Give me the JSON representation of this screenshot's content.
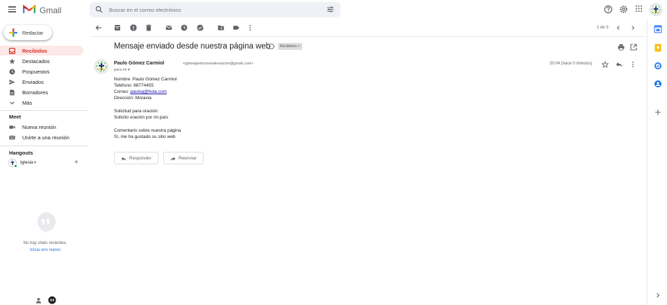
{
  "app": {
    "name": "Gmail"
  },
  "search": {
    "placeholder": "Buscar en el correo electrónico"
  },
  "compose": {
    "label": "Redactar"
  },
  "nav": [
    {
      "label": "Recibidos",
      "icon": "inbox-icon",
      "active": true
    },
    {
      "label": "Destacados",
      "icon": "star-icon"
    },
    {
      "label": "Pospuestos",
      "icon": "clock-icon"
    },
    {
      "label": "Enviados",
      "icon": "send-icon"
    },
    {
      "label": "Borradores",
      "icon": "draft-icon"
    },
    {
      "label": "Más",
      "icon": "chevron-down-icon"
    }
  ],
  "meet": {
    "title": "Meet",
    "items": [
      {
        "label": "Nueva reunión",
        "icon": "video-icon"
      },
      {
        "label": "Unirte a una reunión",
        "icon": "keyboard-icon"
      }
    ]
  },
  "hangouts": {
    "title": "Hangouts",
    "user": "Iglesia",
    "caret": "▾",
    "add": "+",
    "no_chats": "No hay chats recientes.",
    "start_chat": "Inicia uno nuevo"
  },
  "toolbar": {
    "page_count": "1 de 3"
  },
  "email": {
    "subject": "Mensaje enviado desde nuestra página web",
    "label": "Recibidos ×",
    "sender_name": "Paulo Gómez Carmiol",
    "sender_email": "<iglesiapeticionesdeoracion@gmail.com>",
    "to": "para mí ▾",
    "timestamp": "20:04 (hace 0 minutos)",
    "body": {
      "nombre": "Nombre: Paulo Gómez Carmiol",
      "telefono": "Teléfono: 88774455",
      "correo_label": "Correo: ",
      "correo_link": "paulog@hola.com",
      "direccion": "Dirección: Moravia",
      "solicitud_title": "Solicitud para oración:",
      "solicitud_text": "Solicito oración por mi país",
      "comentario_title": "Comentario sobre nuestra página",
      "comentario_text": "Sí, me ha gustado su sitio web"
    },
    "reply_label": "Responder",
    "forward_label": "Reenviar"
  },
  "colors": {
    "accent_red": "#d93025",
    "active_bg": "#fce8e6",
    "link": "#1a73e8"
  }
}
